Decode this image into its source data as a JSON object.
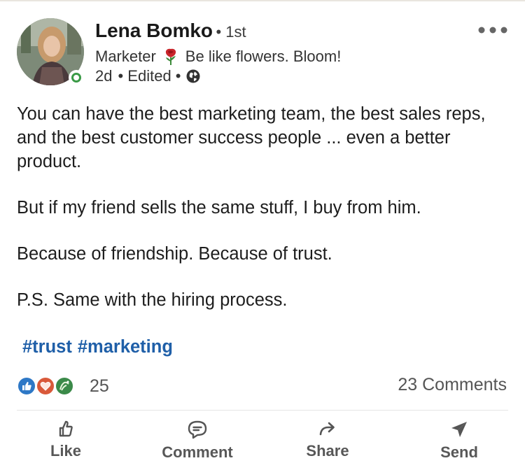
{
  "author": {
    "name": "Lena Bomko",
    "degree": "• 1st",
    "headline_role": "Marketer",
    "headline_tagline": "Be like flowers. Bloom!",
    "time": "2d",
    "edited": "• Edited •"
  },
  "post": {
    "paragraphs": [
      "You can have the best marketing team, the best sales reps, and the best customer success people ... even a better product.",
      "But if my friend sells the same stuff, I buy from him.",
      "Because of friendship. Because of trust.",
      "P.S. Same with the hiring process."
    ],
    "hashtags": [
      "#trust",
      "#marketing"
    ]
  },
  "social": {
    "reaction_count": "25",
    "comments": "23 Comments"
  },
  "actions": {
    "like": "Like",
    "comment": "Comment",
    "share": "Share",
    "send": "Send"
  },
  "colors": {
    "link": "#1f5fa8",
    "online": "#3a9a46",
    "like_reaction": "#2e78c6",
    "love_reaction": "#d9593a",
    "celebrate_reaction": "#3b8a49"
  },
  "icons": [
    "more-options-icon",
    "rose-emoji-icon",
    "globe-icon",
    "like-icon",
    "comment-icon",
    "share-icon",
    "send-icon"
  ]
}
